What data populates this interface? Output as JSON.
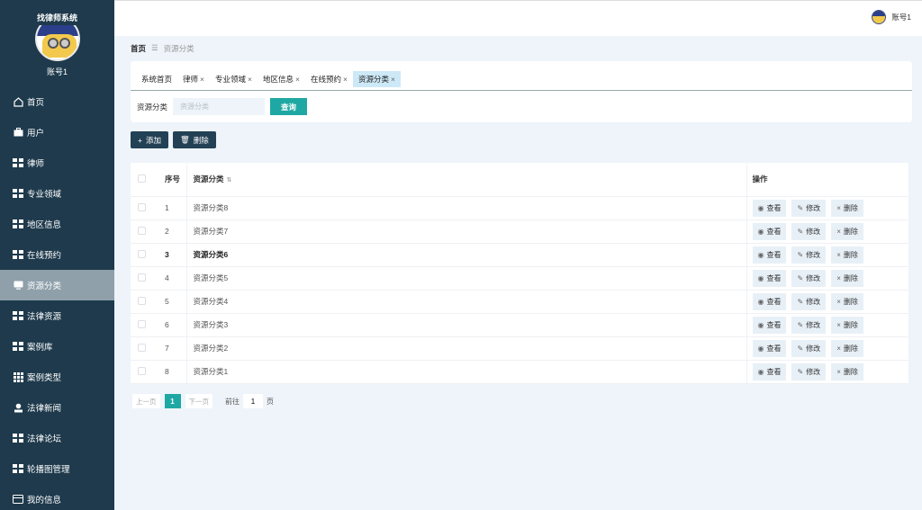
{
  "sidebar": {
    "system_title": "找律师系统",
    "account_name": "账号1",
    "items": [
      {
        "label": "首页",
        "icon": "home-icon"
      },
      {
        "label": "用户",
        "icon": "briefcase-icon"
      },
      {
        "label": "律师",
        "icon": "grid-icon"
      },
      {
        "label": "专业领域",
        "icon": "grid-icon"
      },
      {
        "label": "地区信息",
        "icon": "grid-icon"
      },
      {
        "label": "在线预约",
        "icon": "grid-icon"
      },
      {
        "label": "资源分类",
        "icon": "monitor-icon"
      },
      {
        "label": "法律资源",
        "icon": "grid-icon"
      },
      {
        "label": "案例库",
        "icon": "grid-icon"
      },
      {
        "label": "案例类型",
        "icon": "grid9-icon"
      },
      {
        "label": "法律新闻",
        "icon": "user-icon"
      },
      {
        "label": "法律论坛",
        "icon": "grid-icon"
      },
      {
        "label": "轮播图管理",
        "icon": "grid-icon"
      },
      {
        "label": "我的信息",
        "icon": "card-icon"
      }
    ],
    "active_index": 6
  },
  "header": {
    "user_name": "账号1"
  },
  "breadcrumb": {
    "home": "首页",
    "separator": "☰",
    "current": "资源分类"
  },
  "tabs": [
    {
      "label": "系统首页",
      "closable": false
    },
    {
      "label": "律师",
      "closable": true
    },
    {
      "label": "专业领域",
      "closable": true
    },
    {
      "label": "地区信息",
      "closable": true
    },
    {
      "label": "在线预约",
      "closable": true
    },
    {
      "label": "资源分类",
      "closable": true,
      "active": true
    }
  ],
  "search": {
    "label": "资源分类",
    "placeholder": "资源分类",
    "button": "查询"
  },
  "toolbar": {
    "add_label": "添加",
    "delete_label": "删除"
  },
  "table": {
    "headers": {
      "index": "序号",
      "name": "资源分类",
      "ops": "操作"
    },
    "rows": [
      {
        "index": "1",
        "name": "资源分类8"
      },
      {
        "index": "2",
        "name": "资源分类7"
      },
      {
        "index": "3",
        "name": "资源分类6"
      },
      {
        "index": "4",
        "name": "资源分类5"
      },
      {
        "index": "5",
        "name": "资源分类4"
      },
      {
        "index": "6",
        "name": "资源分类3"
      },
      {
        "index": "7",
        "name": "资源分类2"
      },
      {
        "index": "8",
        "name": "资源分类1"
      }
    ],
    "highlight_row": 2,
    "ops": {
      "view": "查看",
      "edit": "修改",
      "delete": "删除"
    }
  },
  "pagination": {
    "prev": "上一页",
    "page": "1",
    "next": "下一页",
    "goto_label": "前往",
    "goto_value": "1",
    "page_unit": "页"
  },
  "colors": {
    "sidebar_bg": "#1e3a4c",
    "accent": "#1fa8a3",
    "active_tab": "#cde9f7",
    "page_bg": "#eef4fa"
  }
}
